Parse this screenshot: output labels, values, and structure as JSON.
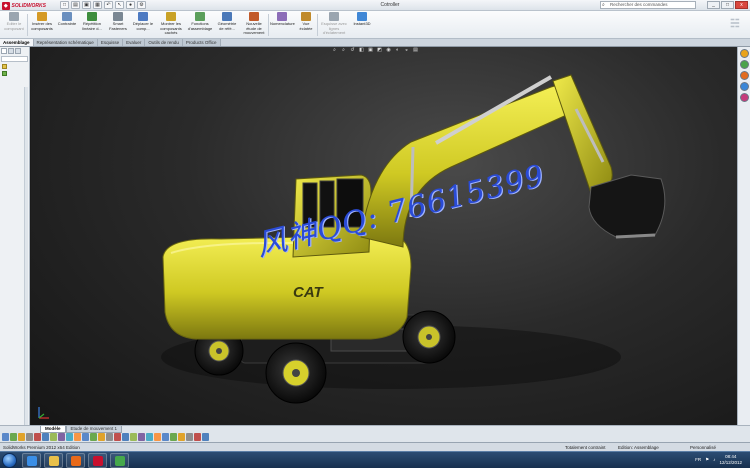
{
  "app": {
    "logo_text": "SOLIDWORKS",
    "document_title": "Cotroller",
    "search_placeholder": "Rechercher des commandes",
    "window_controls": [
      "_",
      "□",
      "x"
    ]
  },
  "ribbon": {
    "buttons": [
      {
        "id": "edit-component",
        "label": "Editer le composant",
        "disabled": true,
        "color": "#9aa5b0"
      },
      {
        "id": "insert-components",
        "label": "Insérer des composants",
        "disabled": false,
        "color": "#d59a25"
      },
      {
        "id": "mate",
        "label": "Contrainte",
        "disabled": false,
        "color": "#6a8fbf"
      },
      {
        "id": "linear-pattern",
        "label": "Répétition linéaire d...",
        "disabled": false,
        "color": "#3e8e3e"
      },
      {
        "id": "smart-fasteners",
        "label": "Smart Fasteners",
        "disabled": false,
        "color": "#7a8793"
      },
      {
        "id": "move-component",
        "label": "Déplacer le comp...",
        "disabled": false,
        "color": "#4d7ac2"
      },
      {
        "id": "show-hidden",
        "label": "Montrer les composants cachés",
        "disabled": false,
        "color": "#c9a227"
      },
      {
        "id": "assembly-features",
        "label": "Fonctions d'assemblage",
        "disabled": false,
        "color": "#5b9f5b"
      },
      {
        "id": "reference-geometry",
        "label": "Géométrie de réfé...",
        "disabled": false,
        "color": "#4a78b8"
      },
      {
        "id": "new-motion-study",
        "label": "Nouvelle étude de mouvement",
        "disabled": false,
        "color": "#c25a2a"
      },
      {
        "id": "bom",
        "label": "Nomenclature",
        "disabled": false,
        "color": "#8c6db8"
      },
      {
        "id": "exploded-view",
        "label": "Vue éclatée",
        "disabled": false,
        "color": "#c08a2b"
      },
      {
        "id": "explode-line-sketch",
        "label": "Esquisse avec lignes d'éclatement",
        "disabled": true,
        "color": "#9aa5b0"
      },
      {
        "id": "instant3d",
        "label": "Instant3D",
        "disabled": false,
        "color": "#3f87d6"
      }
    ]
  },
  "tabs": [
    "Assemblage",
    "Représentation schématique",
    "Esquisse",
    "Evaluer",
    "Outils de rendu",
    "Products Office"
  ],
  "active_tab": 0,
  "feature_tree": {
    "rows": [
      {
        "label": ""
      },
      {
        "label": ""
      }
    ]
  },
  "viewport": {
    "watermark": "风神QQ: 76615399",
    "model_decal": "CAT",
    "body_color": "#d8d32a"
  },
  "bottom_tabs": [
    "Modèle",
    "Etude de mouvement 1"
  ],
  "active_bottom_tab": 0,
  "status": {
    "app_version": "SolidWorks Premium 2012 x64 Edition",
    "constraint_status": "Totalement contraint",
    "edit_mode": "Edition: Assemblage",
    "units": "Personnalisé"
  },
  "taskbar": {
    "lang": "FR",
    "time": "08:44",
    "date": "12/12/2012",
    "apps": [
      {
        "name": "ie-icon",
        "color": "#3a8ee6"
      },
      {
        "name": "explorer-icon",
        "color": "#e8c04a"
      },
      {
        "name": "media-player-icon",
        "color": "#e86a1a"
      },
      {
        "name": "solidworks-icon",
        "color": "#c8102e"
      },
      {
        "name": "chrome-icon",
        "color": "#46a84b"
      }
    ]
  }
}
